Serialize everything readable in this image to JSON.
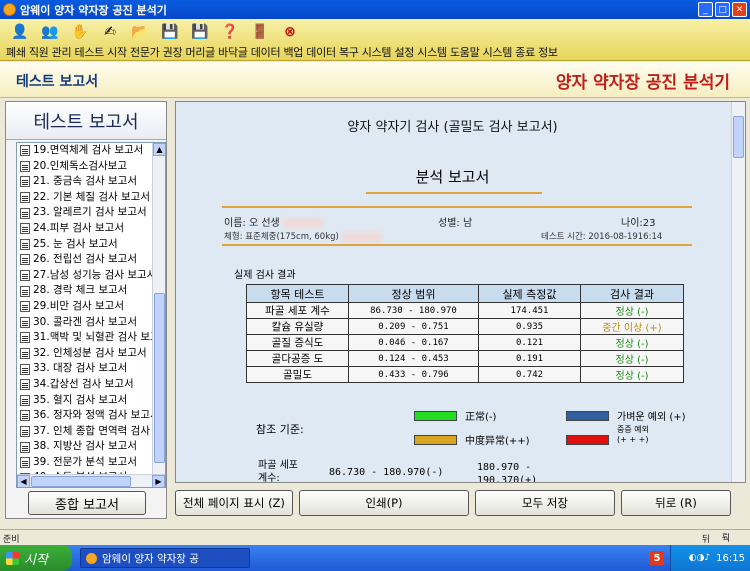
{
  "window": {
    "title": "암웨이 양자 약자장 공진 분석기"
  },
  "toolbar": {
    "icons": [
      "person-icon",
      "users-icon",
      "hand-icon",
      "advice-icon",
      "folder-icon",
      "disk-icon",
      "disk-save-icon",
      "help-icon",
      "door-icon",
      "close-icon"
    ],
    "labels": "폐쇄  직원 관리 테스트 시작 전문가 권장 머리글 바닥글 데이터 백업 데이터 복구 시스템 설정 시스템 도움말 시스템 종료 정보"
  },
  "header": {
    "left": "테스트 보고서",
    "right": "양자 약자장 공진 분석기"
  },
  "sidebar": {
    "title": "테스트 보고서",
    "items": [
      "19.면역체계 검사 보고서",
      "20.인체독소검사보고",
      "21. 중금속 검사 보고서",
      "22. 기본 체질 검사 보고서",
      "23. 알레르기 검사 보고서",
      "24.피부 검사 보고서",
      "25. 눈 검사 보고서",
      "26. 전립선 검사 보고서",
      "27.남성 성기능 검사 보고서",
      "28. 경락 체크 보고서",
      "29.비만 검사 보고서",
      "30. 콜라겐 검사 보고서",
      "31.맥박 및 뇌혈관 검사 보고서",
      "32. 인체성분 검사 보고서",
      "33. 대장 검사 보고서",
      "34.갑상선 검사 보고서",
      "35. 혈지 검사 보고서",
      "36. 정자와 정액 검사 보고서",
      "37. 인체 종합 면역력 검사",
      "38. 지방산 검사 보고서",
      "39. 전문가 분석 보고서",
      "40. 수동 분석 보고서"
    ],
    "summary_button": "종합 보고서"
  },
  "report": {
    "title": "양자 약자기 검사 (골밀도 검사 보고서)",
    "subtitle": "분석 보고서",
    "name": "이름: 오 선생",
    "gender": "성별: 남",
    "age": "나이:23",
    "body_type": "체형: 표준체중(175cm, 60kg)",
    "test_time": "테스트 시간: 2016-08-1916:14",
    "section_title": "실제 검사 결과",
    "table": {
      "headers": [
        "항목 테스트",
        "정상 범위",
        "실제 측정값",
        "검사 결과"
      ],
      "rows": [
        {
          "item": "파골 세포 계수",
          "range": "86.730 - 180.970",
          "value": "174.451",
          "result": "정상 (-)",
          "status": "ok"
        },
        {
          "item": "칼슘 유실량",
          "range": "0.209 - 0.751",
          "value": "0.935",
          "result": "중간 이상 (+)",
          "status": "mid"
        },
        {
          "item": "골질 증식도",
          "range": "0.046 - 0.167",
          "value": "0.121",
          "result": "정상 (-)",
          "status": "ok"
        },
        {
          "item": "골다공증 도",
          "range": "0.124 - 0.453",
          "value": "0.191",
          "result": "정상 (-)",
          "status": "ok"
        },
        {
          "item": "골밀도",
          "range": "0.433 - 0.796",
          "value": "0.742",
          "result": "정상 (-)",
          "status": "ok"
        }
      ]
    },
    "legend_label": "참조 기준:",
    "legend": [
      {
        "label": "正常(-)",
        "color": "#22dd22"
      },
      {
        "label": "가벼운 예외 (+)",
        "color": "#2f5f9e"
      },
      {
        "label": "中度异常(++)",
        "color": "#d9a520"
      },
      {
        "label": "중증 예외",
        "label2": "(+ + +)",
        "color": "#e01010"
      }
    ],
    "bottom": {
      "label": "파골 세포\n계수:",
      "range": "86.730 - 180.970(-)",
      "value": "180.970 -\n190.370(+)"
    }
  },
  "actions": {
    "full_page": "전체 페이지 표시 (Z)",
    "print": "인쇄(P)",
    "save_all": "모두 저장",
    "back": "뒤로 (R)"
  },
  "status": {
    "left": "준비",
    "right": "뒤",
    "right2": "뤅"
  },
  "taskbar": {
    "start": "시작",
    "task": "암웨이 양자 약자장 공",
    "time": "16:15",
    "tray_badge": "5"
  }
}
